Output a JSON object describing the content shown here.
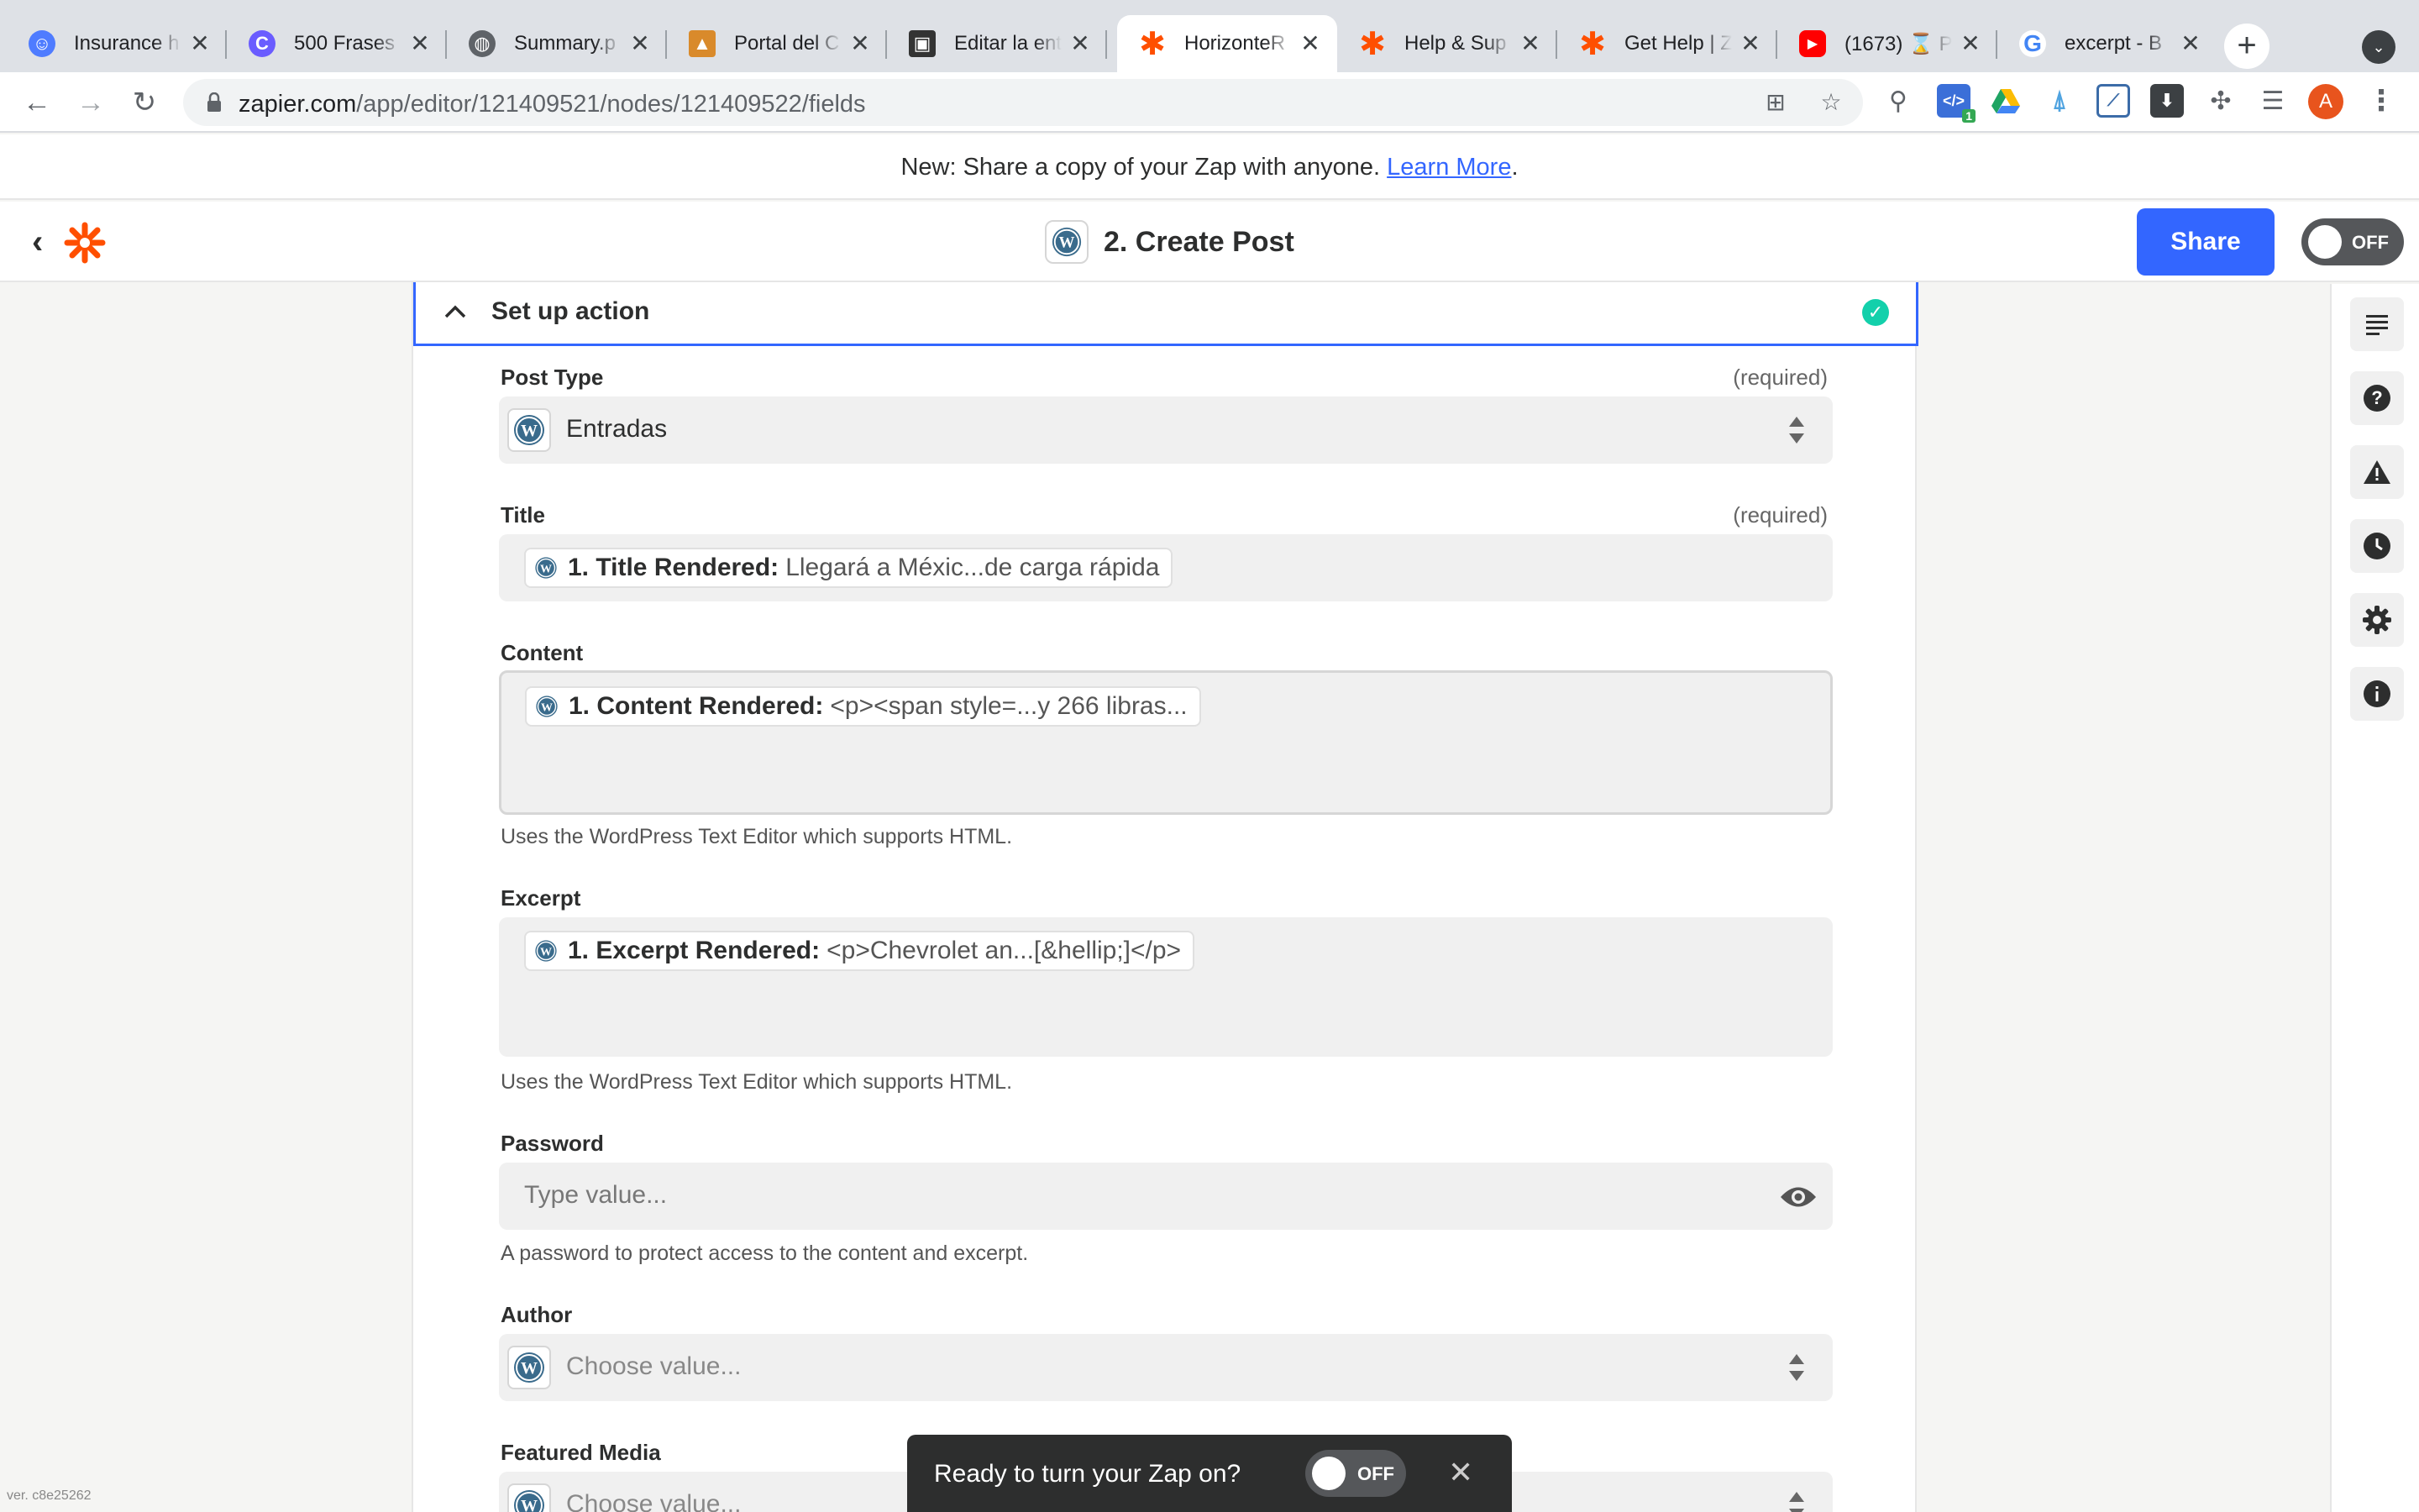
{
  "browser": {
    "tabs": [
      {
        "title": "Insurance h",
        "icon": "robot-favicon-icon",
        "color": "#4f7cff",
        "glyph": "☺"
      },
      {
        "title": "500 Frases",
        "icon": "c-circle-favicon-icon",
        "color": "#6a5cff",
        "glyph": "C"
      },
      {
        "title": "Summary.p",
        "icon": "globe-favicon-icon",
        "color": "#5f6368",
        "glyph": "◍"
      },
      {
        "title": "Portal del C",
        "icon": "portal-favicon-icon",
        "color": "#d98a2b",
        "glyph": "▲"
      },
      {
        "title": "Editar la ent",
        "icon": "editor-favicon-icon",
        "color": "#333333",
        "glyph": "▣"
      },
      {
        "title": "HorizonteR",
        "icon": "zapier-favicon-icon",
        "color": "#ff4f00",
        "glyph": "✱"
      },
      {
        "title": "Help & Sup",
        "icon": "zapier-favicon-icon",
        "color": "#ff4f00",
        "glyph": "✱"
      },
      {
        "title": "Get Help | Z",
        "icon": "zapier-favicon-icon",
        "color": "#ff4f00",
        "glyph": "✱"
      },
      {
        "title": "(1673) ⌛ P",
        "icon": "youtube-favicon-icon",
        "color": "#ff0000",
        "glyph": "▶"
      },
      {
        "title": "excerpt - B",
        "icon": "google-favicon-icon",
        "color": "#4285f4",
        "glyph": "G"
      }
    ],
    "close_glyph": "✕",
    "new_tab_glyph": "+",
    "tab_search_glyph": "⌄",
    "back_glyph": "←",
    "forward_glyph": "→",
    "reload_glyph": "↻",
    "url_host": "zapier.com",
    "url_path": "/app/editor/121409521/nodes/121409522/fields",
    "translate_glyph": "⊞",
    "star_glyph": "☆",
    "avatar_letter": "A",
    "menu_glyph": "⋮",
    "ext_badge": "1"
  },
  "banner": {
    "text": "New: Share a copy of your Zap with anyone. ",
    "link": "Learn More",
    "suffix": "."
  },
  "header": {
    "back_glyph": "‹",
    "step_title": "2. Create Post",
    "share_label": "Share",
    "toggle_label": "OFF"
  },
  "section": {
    "title": "Set up action",
    "chevron": "⌃",
    "check": "✓"
  },
  "fields": {
    "post_type": {
      "label": "Post Type",
      "required": "(required)",
      "value": "Entradas"
    },
    "title": {
      "label": "Title",
      "required": "(required)",
      "pill_key": "1. Title Rendered:",
      "pill_value": "Llegará a Méxic...de carga rápida"
    },
    "content": {
      "label": "Content",
      "pill_key": "1. Content Rendered:",
      "pill_value": "<p><span style=...y 266 libras...",
      "help": "Uses the WordPress Text Editor which supports HTML."
    },
    "excerpt": {
      "label": "Excerpt",
      "pill_key": "1. Excerpt Rendered:",
      "pill_value": "<p>Chevrolet an...[&hellip;]</p>",
      "help": "Uses the WordPress Text Editor which supports HTML."
    },
    "password": {
      "label": "Password",
      "placeholder": "Type value...",
      "help": "A password to protect access to the content and excerpt."
    },
    "author": {
      "label": "Author",
      "placeholder": "Choose value..."
    },
    "featured_media": {
      "label": "Featured Media",
      "placeholder": "Choose value..."
    }
  },
  "version": "ver. c8e25262",
  "toast": {
    "message": "Ready to turn your Zap on?",
    "toggle_label": "OFF",
    "close": "✕"
  },
  "colors": {
    "accent": "#3366ff",
    "zapier_orange": "#ff4f00",
    "success": "#13d0ab"
  }
}
